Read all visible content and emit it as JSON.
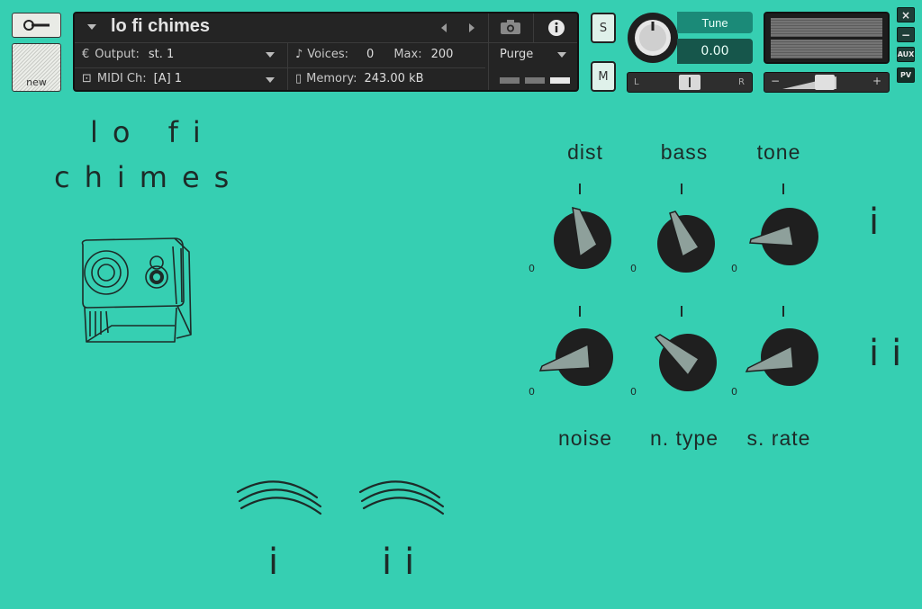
{
  "header": {
    "new_label": "new",
    "instrument_name": "lo fi chimes",
    "output_label": "Output:",
    "output_value": "st. 1",
    "voices_label": "Voices:",
    "voices_value": "0",
    "max_label": "Max:",
    "max_value": "200",
    "purge_label": "Purge",
    "midi_label": "MIDI Ch:",
    "midi_value": "[A]  1",
    "memory_label": "Memory:",
    "memory_value": "243.00 kB",
    "solo_label": "S",
    "mute_label": "M",
    "tune_label": "Tune",
    "tune_value": "0.00",
    "pan_left": "L",
    "pan_right": "R",
    "vol_minus": "−",
    "vol_plus": "+",
    "close_label": "×",
    "minimize_label": "−",
    "aux_label": "AUX",
    "pv_label": "PV"
  },
  "instrument": {
    "title_line1": "lo fi",
    "title_line2": "chimes",
    "row1_labels": [
      "dist",
      "bass",
      "tone"
    ],
    "row2_labels": [
      "noise",
      "n. type",
      "s. rate"
    ],
    "knob_min": "0",
    "row1_numeral": "i",
    "row2_numeral": "ii",
    "chime1_label": "i",
    "chime2_label": "ii"
  },
  "colors": {
    "background": "#36cfb2",
    "knob": "#1f1f1f",
    "pointer": "#8ea09b",
    "ink": "#1d2b28"
  },
  "icons": {
    "tool": "wrench-icon",
    "camera": "camera-icon",
    "info": "info-icon",
    "speaker": "speaker-sketch-icon",
    "chime": "chime-wave-icon"
  }
}
